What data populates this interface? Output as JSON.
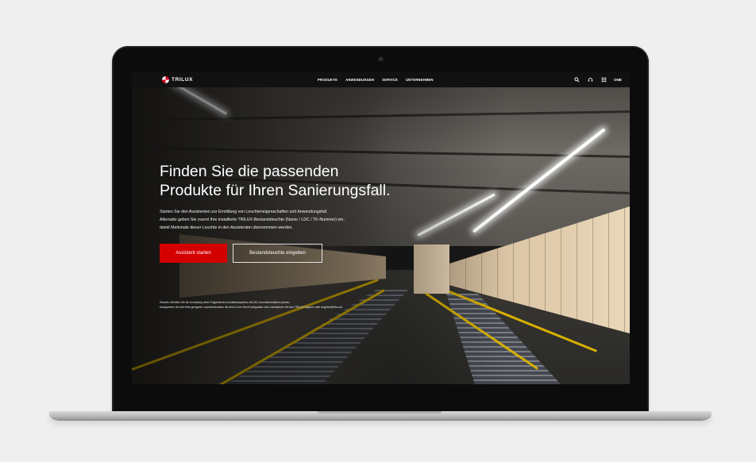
{
  "site": {
    "logo_text": "TRILUX",
    "nav": [
      "PRODUKTE",
      "ANWENDUNGEN",
      "SERVICE",
      "UNTERNEHMEN"
    ],
    "tools": {
      "search_icon": "search-icon",
      "support_icon": "headset-icon",
      "menu_icon": "grid-icon",
      "language": "ONE"
    }
  },
  "hero": {
    "title_line1": "Finden Sie die passenden",
    "title_line2": "Produkte für Ihren Sanierungsfall.",
    "text_line1": "Starten Sie den Assistenten zur Ermittlung von Leuchteneigenschaften und Anwendungsfall.",
    "text_line2": "Alternativ geben Sie zuerst Ihre installierte TRILUX-Bestandsleuchte (Name / LDC / TK-Nummer) ein,",
    "text_line3": "damit Merkmale dieser Leuchte in den Assistenten übernommen werden.",
    "primary_button": "Assistent starten",
    "secondary_button": "Bestandsleuchte eingeben",
    "hint_line1": "Hinweis: Möchten Sie die Umrüstung eines Tragschienen-Lichtbandsystems mit LED-Leuchteneinsätzen planen,",
    "hint_line2": "konfigurieren Sie sich bitte geeignete Leuchteneinsätze mit dem E-Line Next Konfigurator oder kontaktieren Sie den TRILUX Support unter angebot@trilux.de"
  },
  "colors": {
    "accent": "#d40000",
    "nav_bg": "#111111",
    "page_bg": "#efeff0"
  }
}
